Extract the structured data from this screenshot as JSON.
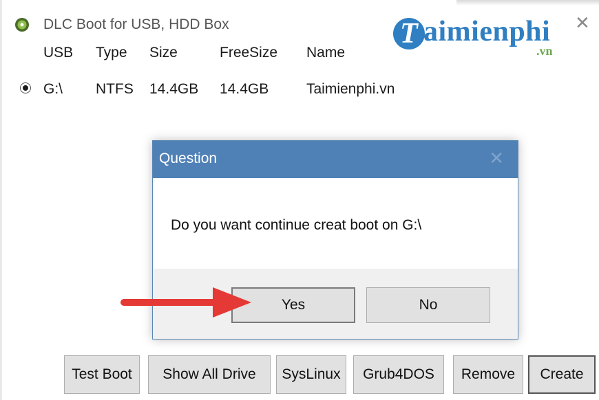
{
  "app": {
    "title": "DLC Boot for USB, HDD Box",
    "close_glyph": "✕",
    "icon": "app-disc-icon"
  },
  "logo": {
    "badge_letter": "T",
    "text": "aimienphi",
    "sub": ".vn",
    "brand_color": "#2f7fc2",
    "sub_color": "#6aa84f"
  },
  "drive_table": {
    "headers": [
      "USB",
      "Type",
      "Size",
      "FreeSize",
      "Name"
    ],
    "rows": [
      {
        "selected": true,
        "usb": "G:\\",
        "type": "NTFS",
        "size": "14.4GB",
        "free": "14.4GB",
        "name": "Taimienphi.vn"
      }
    ]
  },
  "dialog": {
    "title": "Question",
    "close_glyph": "✕",
    "message": "Do you want continue creat boot on G:\\",
    "buttons": {
      "yes": "Yes",
      "no": "No"
    },
    "titlebar_color": "#4f81b7"
  },
  "toolbar": {
    "test_boot": "Test Boot",
    "show_all_drive": "Show All Drive",
    "syslinux": "SysLinux",
    "grub4dos": "Grub4DOS",
    "remove": "Remove",
    "create": "Create"
  },
  "annotation": {
    "arrow_color": "#e53935"
  }
}
